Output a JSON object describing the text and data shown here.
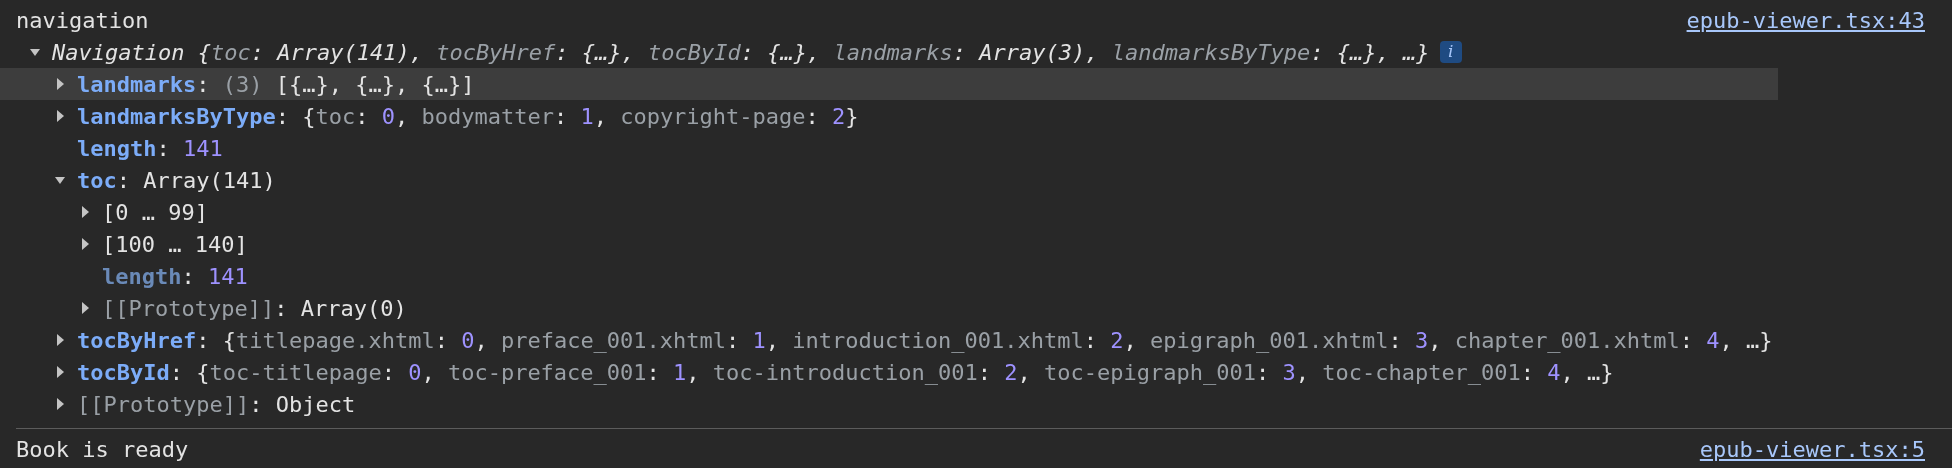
{
  "messages": [
    {
      "text": "navigation",
      "source": "epub-viewer.tsx:43",
      "tree": {
        "kind": "group",
        "expanded": true,
        "hovered": false,
        "badge": "i",
        "preview": [
          {
            "kind": "text",
            "text": "Navigation {"
          },
          {
            "kind": "key",
            "text": "toc"
          },
          {
            "kind": "text",
            "text": ": Array(141), "
          },
          {
            "kind": "key",
            "text": "tocByHref"
          },
          {
            "kind": "text",
            "text": ": {…}, "
          },
          {
            "kind": "key",
            "text": "tocById"
          },
          {
            "kind": "text",
            "text": ": {…}, "
          },
          {
            "kind": "key",
            "text": "landmarks"
          },
          {
            "kind": "text",
            "text": ": Array(3), "
          },
          {
            "kind": "key",
            "text": "landmarksByType"
          },
          {
            "kind": "text",
            "text": ": {…}, …}"
          }
        ],
        "children": [
          {
            "kind": "group",
            "expanded": false,
            "hovered": true,
            "key": {
              "kind": "own",
              "text": "landmarks"
            },
            "preview": [
              {
                "kind": "text",
                "text": ": "
              },
              {
                "kind": "count",
                "text": "(3) "
              },
              {
                "kind": "text",
                "text": "[{…}, {…}, {…}]"
              }
            ]
          },
          {
            "kind": "group",
            "expanded": false,
            "hovered": false,
            "key": {
              "kind": "own",
              "text": "landmarksByType"
            },
            "preview": [
              {
                "kind": "text",
                "text": ": {"
              },
              {
                "kind": "key",
                "text": "toc"
              },
              {
                "kind": "text",
                "text": ": "
              },
              {
                "kind": "number",
                "text": "0"
              },
              {
                "kind": "text",
                "text": ", "
              },
              {
                "kind": "key",
                "text": "bodymatter"
              },
              {
                "kind": "text",
                "text": ": "
              },
              {
                "kind": "number",
                "text": "1"
              },
              {
                "kind": "text",
                "text": ", "
              },
              {
                "kind": "key",
                "text": "copyright-page"
              },
              {
                "kind": "text",
                "text": ": "
              },
              {
                "kind": "number",
                "text": "2"
              },
              {
                "kind": "text",
                "text": "}"
              }
            ]
          },
          {
            "kind": "leaf",
            "hovered": false,
            "key": {
              "kind": "own",
              "text": "length"
            },
            "preview": [
              {
                "kind": "text",
                "text": ": "
              },
              {
                "kind": "number",
                "text": "141"
              }
            ]
          },
          {
            "kind": "group",
            "expanded": true,
            "hovered": false,
            "key": {
              "kind": "own",
              "text": "toc"
            },
            "preview": [
              {
                "kind": "text",
                "text": ": Array(141)"
              }
            ],
            "children": [
              {
                "kind": "group",
                "expanded": false,
                "hovered": false,
                "key": {
                  "kind": "index",
                  "text": "[0 … 99]"
                }
              },
              {
                "kind": "group",
                "expanded": false,
                "hovered": false,
                "key": {
                  "kind": "index",
                  "text": "[100 … 140]"
                }
              },
              {
                "kind": "leaf",
                "hovered": false,
                "key": {
                  "kind": "dim",
                  "text": "length"
                },
                "preview": [
                  {
                    "kind": "text",
                    "text": ": "
                  },
                  {
                    "kind": "number",
                    "text": "141"
                  }
                ]
              },
              {
                "kind": "group",
                "expanded": false,
                "hovered": false,
                "key": {
                  "kind": "internal",
                  "text": "[[Prototype]]"
                },
                "preview": [
                  {
                    "kind": "text",
                    "text": ": Array(0)"
                  }
                ]
              }
            ]
          },
          {
            "kind": "group",
            "expanded": false,
            "hovered": false,
            "key": {
              "kind": "own",
              "text": "tocByHref"
            },
            "preview": [
              {
                "kind": "text",
                "text": ": {"
              },
              {
                "kind": "key",
                "text": "titlepage.xhtml"
              },
              {
                "kind": "text",
                "text": ": "
              },
              {
                "kind": "number",
                "text": "0"
              },
              {
                "kind": "text",
                "text": ", "
              },
              {
                "kind": "key",
                "text": "preface_001.xhtml"
              },
              {
                "kind": "text",
                "text": ": "
              },
              {
                "kind": "number",
                "text": "1"
              },
              {
                "kind": "text",
                "text": ", "
              },
              {
                "kind": "key",
                "text": "introduction_001.xhtml"
              },
              {
                "kind": "text",
                "text": ": "
              },
              {
                "kind": "number",
                "text": "2"
              },
              {
                "kind": "text",
                "text": ", "
              },
              {
                "kind": "key",
                "text": "epigraph_001.xhtml"
              },
              {
                "kind": "text",
                "text": ": "
              },
              {
                "kind": "number",
                "text": "3"
              },
              {
                "kind": "text",
                "text": ", "
              },
              {
                "kind": "key",
                "text": "chapter_001.xhtml"
              },
              {
                "kind": "text",
                "text": ": "
              },
              {
                "kind": "number",
                "text": "4"
              },
              {
                "kind": "text",
                "text": ", …}"
              }
            ]
          },
          {
            "kind": "group",
            "expanded": false,
            "hovered": false,
            "key": {
              "kind": "own",
              "text": "tocById"
            },
            "preview": [
              {
                "kind": "text",
                "text": ": {"
              },
              {
                "kind": "key",
                "text": "toc-titlepage"
              },
              {
                "kind": "text",
                "text": ": "
              },
              {
                "kind": "number",
                "text": "0"
              },
              {
                "kind": "text",
                "text": ", "
              },
              {
                "kind": "key",
                "text": "toc-preface_001"
              },
              {
                "kind": "text",
                "text": ": "
              },
              {
                "kind": "number",
                "text": "1"
              },
              {
                "kind": "text",
                "text": ", "
              },
              {
                "kind": "key",
                "text": "toc-introduction_001"
              },
              {
                "kind": "text",
                "text": ": "
              },
              {
                "kind": "number",
                "text": "2"
              },
              {
                "kind": "text",
                "text": ", "
              },
              {
                "kind": "key",
                "text": "toc-epigraph_001"
              },
              {
                "kind": "text",
                "text": ": "
              },
              {
                "kind": "number",
                "text": "3"
              },
              {
                "kind": "text",
                "text": ", "
              },
              {
                "kind": "key",
                "text": "toc-chapter_001"
              },
              {
                "kind": "text",
                "text": ": "
              },
              {
                "kind": "number",
                "text": "4"
              },
              {
                "kind": "text",
                "text": ", …}"
              }
            ]
          },
          {
            "kind": "group",
            "expanded": false,
            "hovered": false,
            "key": {
              "kind": "internal",
              "text": "[[Prototype]]"
            },
            "preview": [
              {
                "kind": "text",
                "text": ": Object"
              }
            ]
          }
        ]
      }
    },
    {
      "text": "Book is ready",
      "source": "epub-viewer.tsx:5"
    }
  ]
}
